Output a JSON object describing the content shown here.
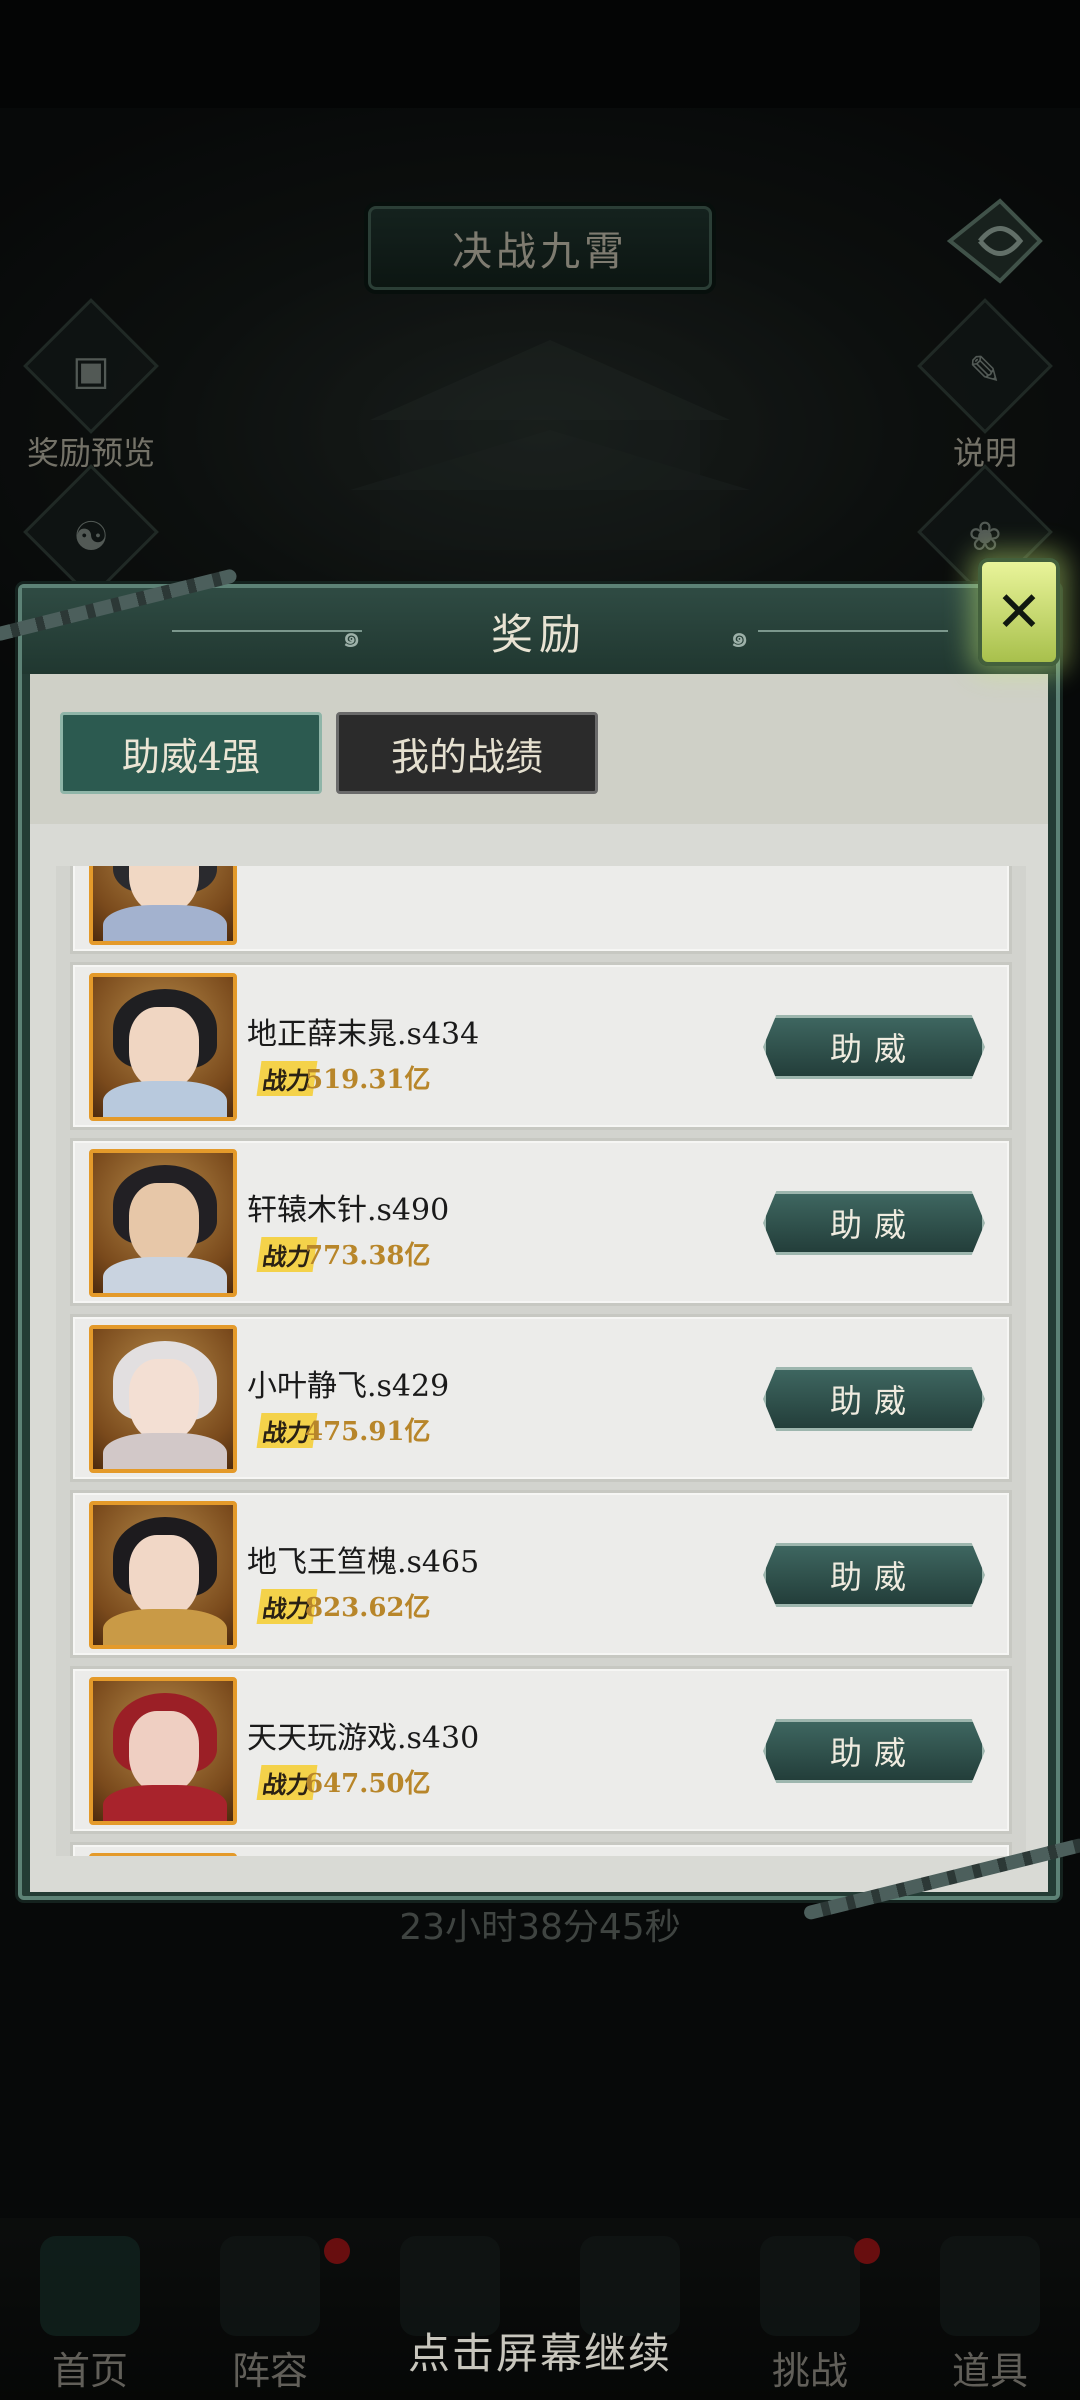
{
  "screen": {
    "event_title": "决战九霄",
    "left_buttons": [
      {
        "label": "奖励预览",
        "icon": "chest-icon"
      },
      {
        "label": "",
        "icon": "dragon-emblem-icon"
      }
    ],
    "right_buttons": [
      {
        "label": "说明",
        "icon": "book-icon"
      },
      {
        "label": "",
        "icon": "lotus-icon"
      }
    ],
    "countdown": "23小时38分45秒",
    "continue_hint": "点击屏幕继续"
  },
  "modal": {
    "title": "奖励",
    "tabs": [
      {
        "label": "助威4强",
        "active": true
      },
      {
        "label": "我的战绩",
        "active": false
      }
    ],
    "power_label": "战力",
    "cheer_label": "助威",
    "players": [
      {
        "name": "",
        "power": "",
        "partial": true
      },
      {
        "name": "地正薛末晁.s434",
        "power": "519.31亿"
      },
      {
        "name": "轩辕木针.s490",
        "power": "773.38亿"
      },
      {
        "name": "小叶静飞.s429",
        "power": "475.91亿"
      },
      {
        "name": "地飞王笪槐.s465",
        "power": "823.62亿"
      },
      {
        "name": "天天玩游戏.s430",
        "power": "647.50亿"
      },
      {
        "name": "",
        "power": "",
        "partial": true
      }
    ]
  },
  "bottom_nav": [
    {
      "label": "首页",
      "active": true,
      "badge": false
    },
    {
      "label": "阵容",
      "active": false,
      "badge": true
    },
    {
      "label": "",
      "active": false,
      "badge": false
    },
    {
      "label": "",
      "active": false,
      "badge": false
    },
    {
      "label": "挑战",
      "active": false,
      "badge": true
    },
    {
      "label": "道具",
      "active": false,
      "badge": false
    }
  ],
  "colors": {
    "modal_frame": "#243c35",
    "tab_active": "#2c5a50",
    "portrait_border": "#e49a2a",
    "power_gold": "#e2b53b",
    "close_glow": "#d4ec7a"
  }
}
